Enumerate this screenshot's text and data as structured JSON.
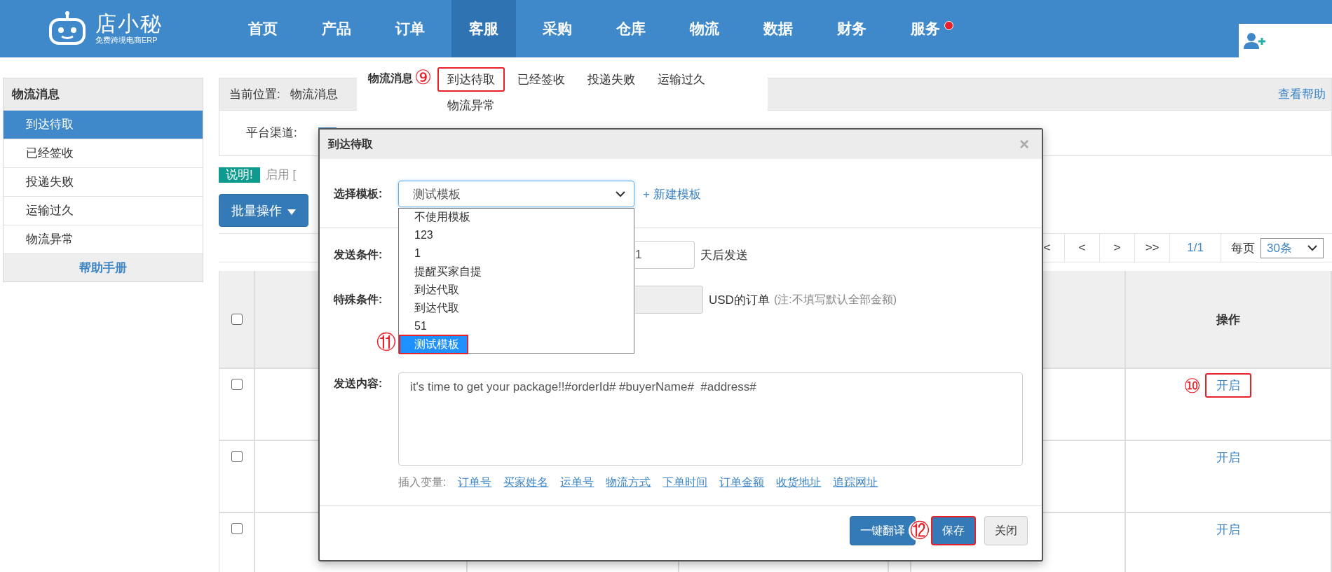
{
  "header": {
    "logo_title": "店小秘",
    "logo_subtitle": "免费跨境电商ERP",
    "nav": [
      {
        "label": "首页",
        "selected": false,
        "badge": false
      },
      {
        "label": "产品",
        "selected": false,
        "badge": false
      },
      {
        "label": "订单",
        "selected": false,
        "badge": false
      },
      {
        "label": "客服",
        "selected": true,
        "badge": false
      },
      {
        "label": "采购",
        "selected": false,
        "badge": false
      },
      {
        "label": "仓库",
        "selected": false,
        "badge": false
      },
      {
        "label": "物流",
        "selected": false,
        "badge": false
      },
      {
        "label": "数据",
        "selected": false,
        "badge": false
      },
      {
        "label": "财务",
        "selected": false,
        "badge": false
      },
      {
        "label": "服务",
        "selected": false,
        "badge": true
      }
    ]
  },
  "submenu": {
    "title": "物流消息",
    "marker": "⑨",
    "items": [
      {
        "label": "到达待取",
        "outlined": true
      },
      {
        "label": "已经签收",
        "outlined": false
      },
      {
        "label": "投递失败",
        "outlined": false
      },
      {
        "label": "运输过久",
        "outlined": false
      },
      {
        "label": "物流异常",
        "outlined": false
      }
    ]
  },
  "sidebar": {
    "title": "物流消息",
    "items": [
      {
        "label": "到达待取",
        "selected": true
      },
      {
        "label": "已经签收",
        "selected": false
      },
      {
        "label": "投递失败",
        "selected": false
      },
      {
        "label": "运输过久",
        "selected": false
      },
      {
        "label": "物流异常",
        "selected": false
      }
    ],
    "footer_link": "帮助手册"
  },
  "breadcrumb": {
    "label": "当前位置:",
    "path": "物流消息",
    "help_link": "查看帮助"
  },
  "filter": {
    "label": "平台渠道:"
  },
  "notice": {
    "badge": "说明!",
    "text": "启用 ["
  },
  "batch_button": "批量操作",
  "pagination": {
    "buttons": [
      "<",
      "<",
      ">",
      ">>"
    ],
    "page": "1/1",
    "per_page_label": "每页",
    "per_page": "30条"
  },
  "table": {
    "header_checked": false,
    "action_column": "操作",
    "rows": [
      {
        "checked": false,
        "action": "开启",
        "outlined": true,
        "marker": "⑩"
      },
      {
        "checked": false,
        "action": "开启",
        "outlined": false
      },
      {
        "checked": false,
        "action": "开启",
        "outlined": false
      }
    ]
  },
  "dialog": {
    "title": "到达待取",
    "close": "×",
    "template_label": "选择模板:",
    "template_value": "测试模板",
    "new_template_link": "+ 新建模板",
    "options": [
      {
        "label": "不使用模板",
        "selected": false,
        "outlined": false
      },
      {
        "label": "123",
        "selected": false,
        "outlined": false
      },
      {
        "label": "1",
        "selected": false,
        "outlined": false
      },
      {
        "label": "提醒买家自提",
        "selected": false,
        "outlined": false
      },
      {
        "label": "到达代取",
        "selected": false,
        "outlined": false
      },
      {
        "label": "到达代取",
        "selected": false,
        "outlined": false
      },
      {
        "label": "51",
        "selected": false,
        "outlined": false
      },
      {
        "label": "测试模板",
        "selected": true,
        "outlined": true,
        "marker": "⑪"
      }
    ],
    "send_condition_label": "发送条件:",
    "send_days": "1",
    "send_suffix": "天后发送",
    "special_label": "特殊条件:",
    "special_suffix": "USD的订单",
    "special_note": "(注:不填写默认全部金额)",
    "content_label": "发送内容:",
    "content": "it's time to get your package!!#orderId# #buyerName#  #address#",
    "variables_label": "插入变量:",
    "variables": [
      "订单号",
      "买家姓名",
      "运单号",
      "物流方式",
      "下单时间",
      "订单金额",
      "收货地址",
      "追踪网址"
    ],
    "buttons": [
      {
        "label": "一键翻译",
        "kind": "primary",
        "outlined": false
      },
      {
        "label": "保存",
        "kind": "primary",
        "outlined": true,
        "marker": "⑫"
      },
      {
        "label": "关闭",
        "kind": "default",
        "outlined": false
      }
    ]
  }
}
